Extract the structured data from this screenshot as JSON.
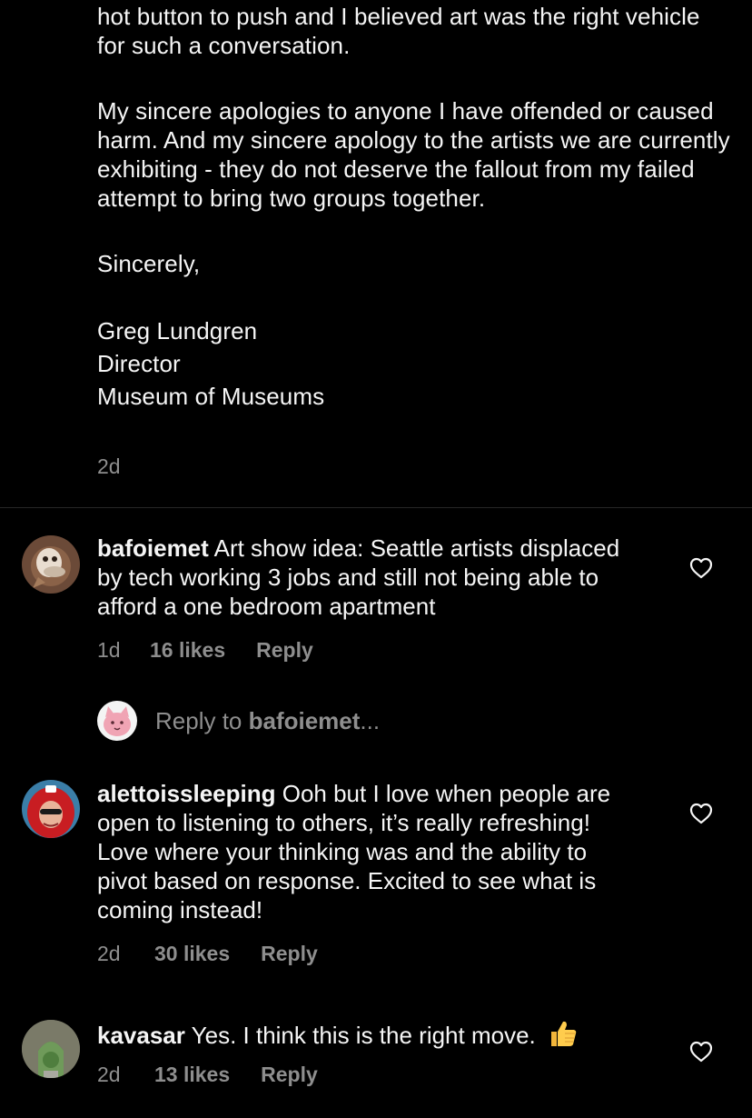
{
  "post": {
    "caption_paragraphs": [
      "hot button to push and I believed art was the right vehicle for such a conversation.",
      "My sincere apologies to anyone I have offended or caused harm. And my sincere apology to the artists we are currently exhibiting - they do not deserve the fallout from my failed attempt to bring two groups together.",
      "Sincerely,"
    ],
    "signature": {
      "name": "Greg Lundgren",
      "title": "Director",
      "organization": "Museum of Museums"
    },
    "time": "2d"
  },
  "comments": [
    {
      "username": "bafoiemet",
      "text": "Art show idea: Seattle artists displaced by tech working 3 jobs and still not being able to afford a one bedroom apartment",
      "time": "1d",
      "likes": "16 likes",
      "reply_label": "Reply",
      "avatar_icon": "brown-cartoon-avatar"
    },
    {
      "username": "alettoissleeping",
      "text": "Ooh but I love when people are open to listening to others, it’s really refreshing! Love where your thinking was and the ability to pivot based on response. Excited to see what is coming instead!",
      "time": "2d",
      "likes": "30 likes",
      "reply_label": "Reply",
      "avatar_icon": "red-hood-photo-avatar"
    },
    {
      "username": "kavasar",
      "text": "Yes. I think this is the right move.",
      "emoji": "thumbs-up-emoji",
      "time": "2d",
      "likes": "13 likes",
      "reply_label": "Reply",
      "avatar_icon": "stone-arch-photo-avatar"
    }
  ],
  "reply_composer": {
    "prefix": "Reply to ",
    "mention": "bafoiemet",
    "suffix": "...",
    "avatar_icon": "pink-cat-avatar"
  },
  "colors": {
    "background": "#000000",
    "text": "#f5f5f5",
    "secondary_text": "#8e8e8e",
    "divider": "#262626"
  },
  "icons": {
    "like": "heart-outline-icon"
  }
}
